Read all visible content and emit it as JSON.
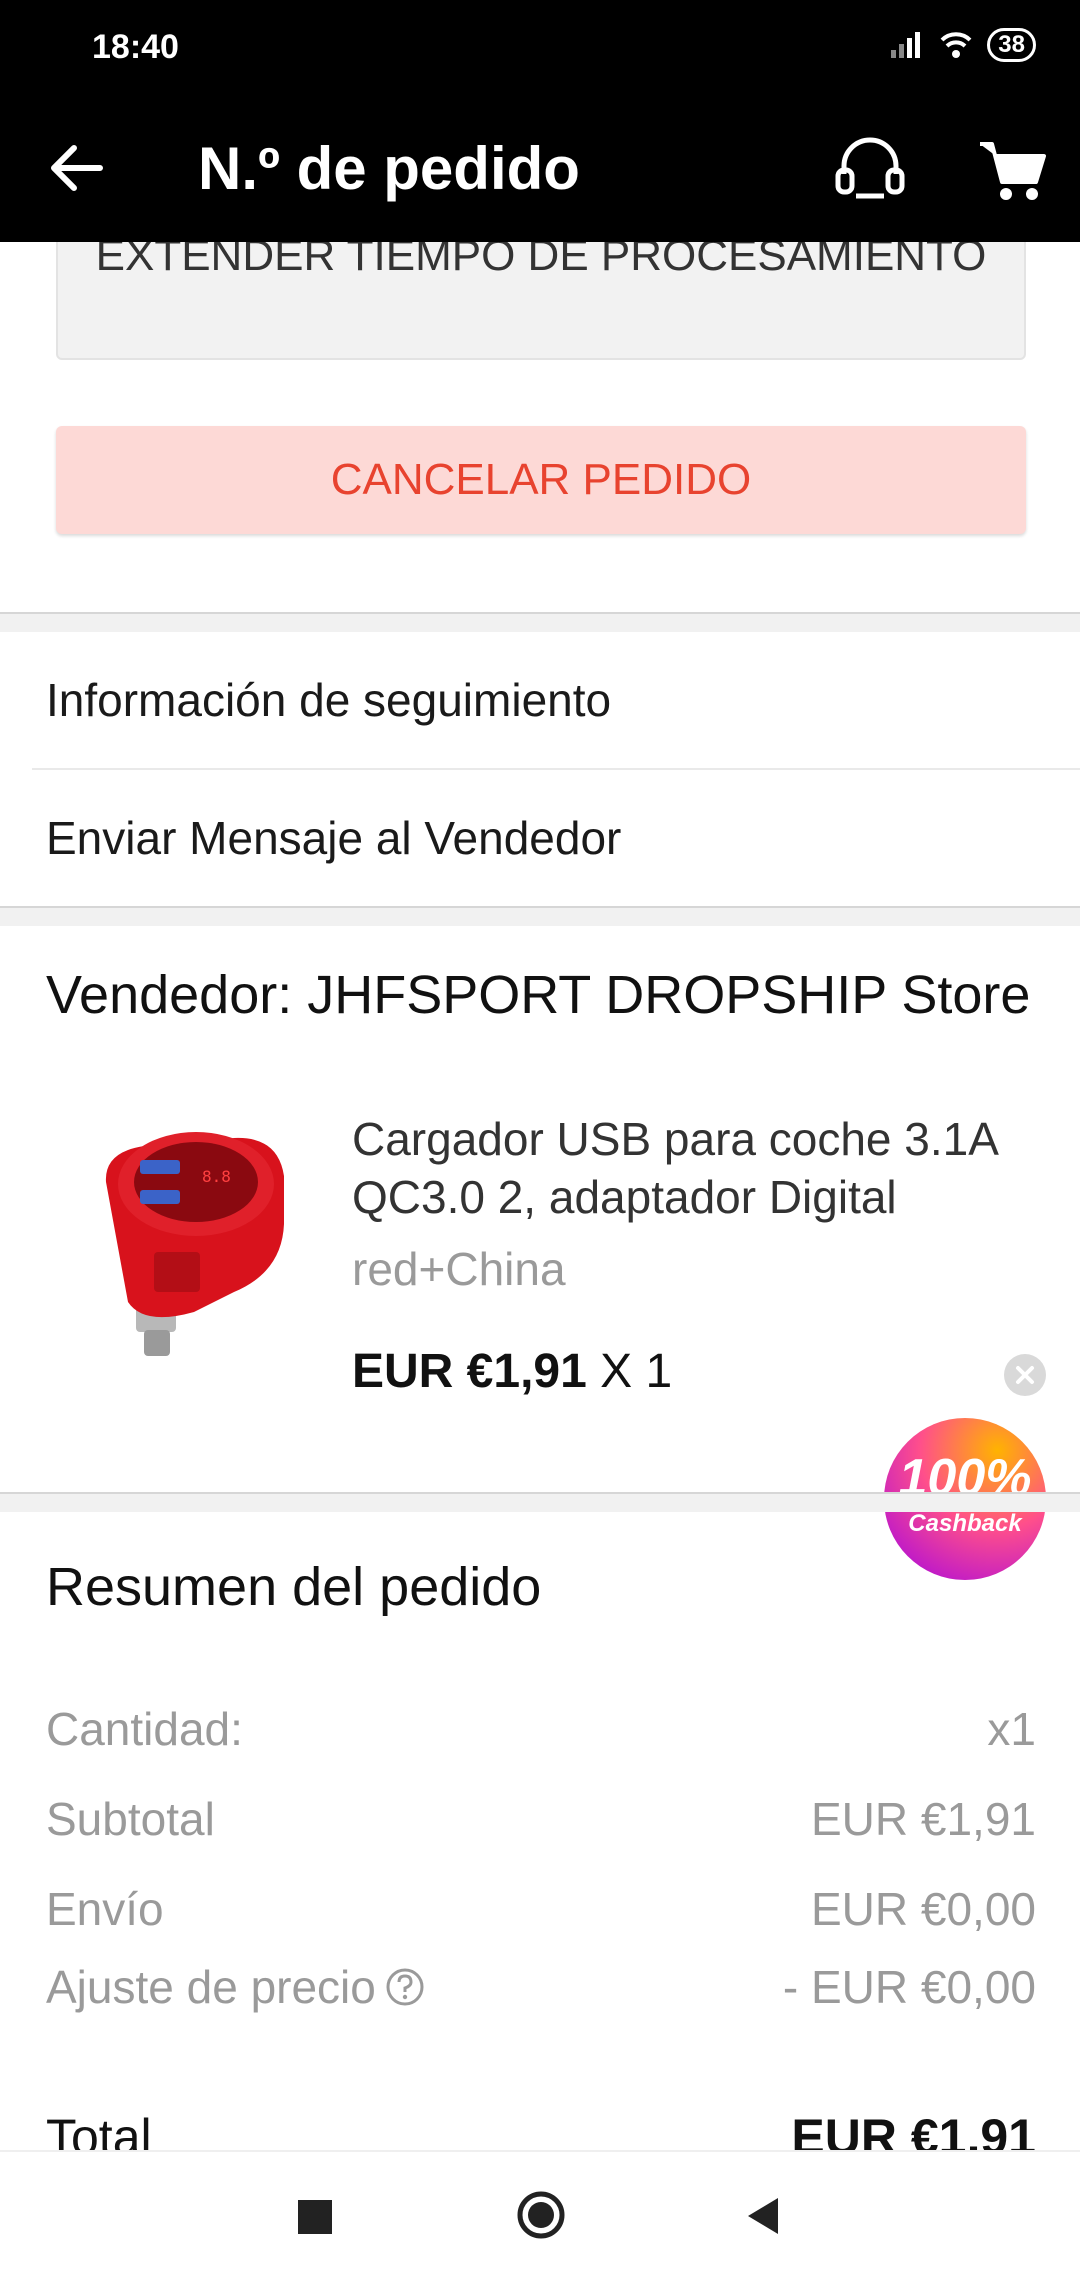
{
  "status_bar": {
    "time": "18:40",
    "battery": "38"
  },
  "app_bar": {
    "title": "N.º de pedido"
  },
  "actions": {
    "extend_label": "EXTENDER TIEMPO DE PROCESAMIENTO",
    "cancel_label": "CANCELAR PEDIDO"
  },
  "links": {
    "tracking": "Información de seguimiento",
    "message_seller": "Enviar Mensaje al Vendedor"
  },
  "seller": {
    "label": "Vendedor: JHFSPORT DROPSHIP Store"
  },
  "product": {
    "title": "Cargador USB para coche 3.1A QC3.0 2, adaptador Digital",
    "variant": "red+China",
    "price": "EUR €1,91",
    "quantity": "X 1"
  },
  "cashback": {
    "percent": "100%",
    "text": "Cashback"
  },
  "summary": {
    "title": "Resumen del pedido",
    "rows": [
      {
        "label": "Cantidad:",
        "value": "x1"
      },
      {
        "label": "Subtotal",
        "value": "EUR €1,91"
      },
      {
        "label": "Envío",
        "value": "EUR €0,00"
      },
      {
        "label": "Ajuste de precio",
        "value": "- EUR €0,00"
      }
    ],
    "total_label": "Total",
    "total_value": "EUR €1,91"
  },
  "colors": {
    "accent": "#e8432f",
    "cancel_bg": "#fdd9d6",
    "app_bar": "#000000"
  },
  "icons": [
    "back-arrow-icon",
    "headset-icon",
    "cart-icon",
    "help-circle-icon",
    "close-icon"
  ]
}
